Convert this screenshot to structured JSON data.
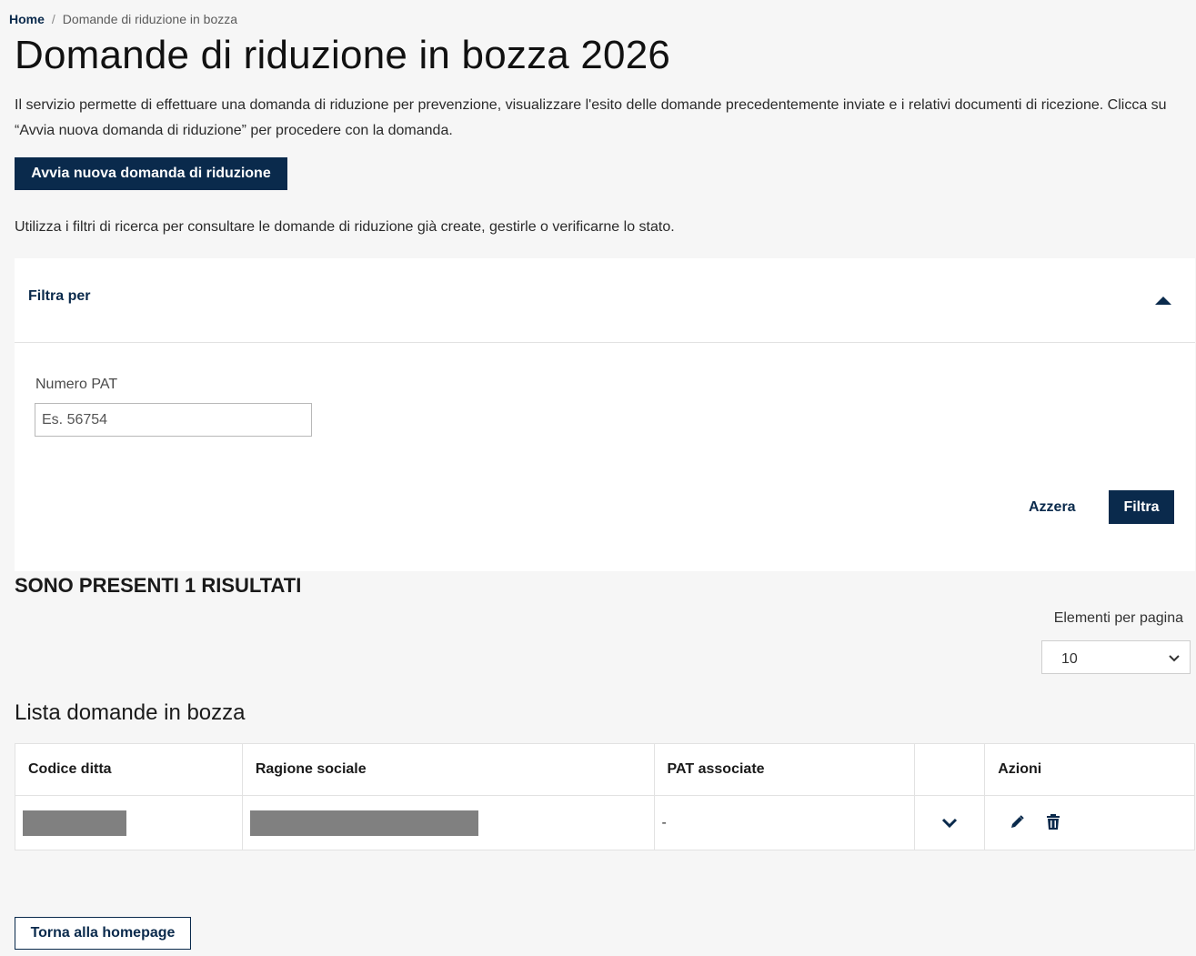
{
  "breadcrumb": {
    "home": "Home",
    "separator": "/",
    "current": "Domande di riduzione in bozza"
  },
  "page": {
    "title": "Domande di riduzione in bozza 2026",
    "intro": "Il servizio permette di effettuare una domanda di riduzione per prevenzione, visualizzare l'esito delle domande precedentemente inviate e i relativi documenti di ricezione. Clicca su “Avvia nuova domanda di riduzione” per procedere con la domanda.",
    "new_button": "Avvia nuova domanda di riduzione",
    "hint": "Utilizza i filtri di ricerca per consultare le domande di riduzione già create, gestirle o verificarne lo stato."
  },
  "filters": {
    "title": "Filtra per",
    "expanded": true,
    "pat_label": "Numero PAT",
    "pat_placeholder": "Es. 56754",
    "pat_value": "",
    "reset_label": "Azzera",
    "submit_label": "Filtra"
  },
  "results": {
    "summary": "SONO PRESENTI 1 RISULTATI",
    "per_page_label": "Elementi per pagina",
    "per_page_value": "10"
  },
  "list": {
    "title": "Lista domande in bozza",
    "columns": [
      "Codice ditta",
      "Ragione sociale",
      "PAT associate",
      "",
      "Azioni"
    ],
    "rows": [
      {
        "codice_ditta": "[redacted]",
        "ragione_sociale": "[redacted]",
        "pat_associate": "-"
      }
    ]
  },
  "footer": {
    "back_label": "Torna alla homepage"
  },
  "icons": {
    "collapse": "chevron-up-icon",
    "expand_row": "chevron-down-icon",
    "edit": "pencil-icon",
    "delete": "trash-icon"
  },
  "colors": {
    "primary": "#0a2a4c",
    "background": "#f6f6f6",
    "card": "#ffffff",
    "redaction": "#808080"
  }
}
